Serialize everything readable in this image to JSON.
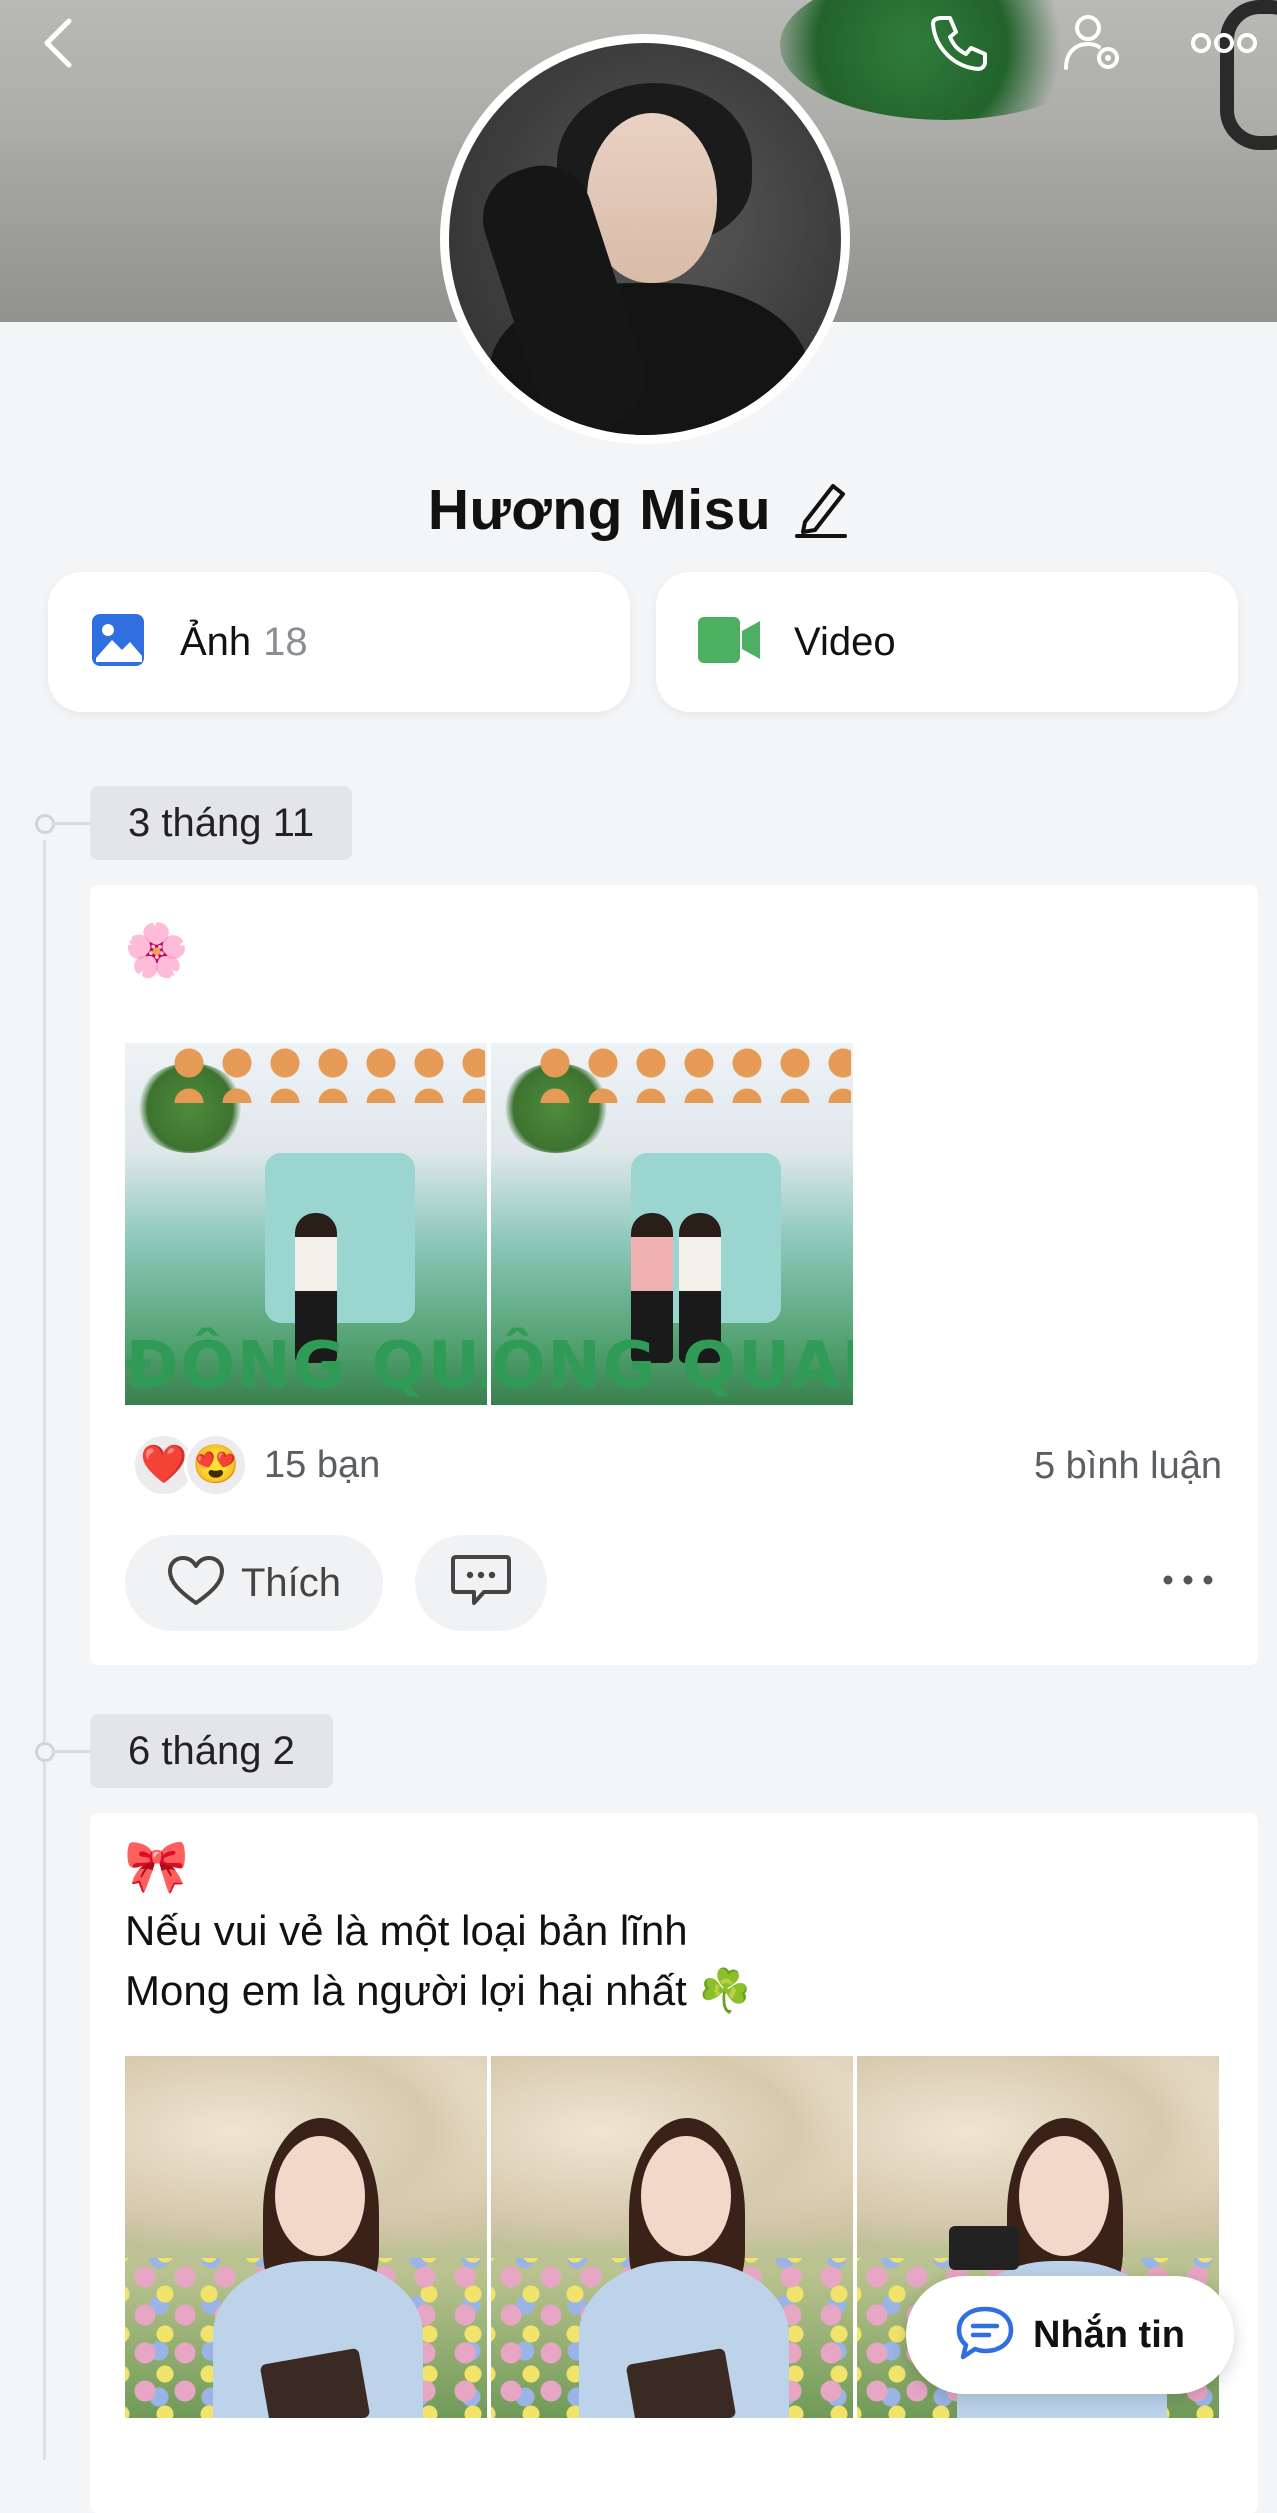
{
  "header": {
    "back_icon": "chevron-left-icon",
    "call_icon": "phone-icon",
    "settings_icon": "user-settings-icon",
    "more_icon": "more-horizontal-icon"
  },
  "profile": {
    "name": "Hương Misu",
    "edit_icon": "pencil-icon"
  },
  "media": {
    "photos": {
      "label": "Ảnh",
      "count": "18",
      "icon": "image-icon",
      "color": "#2f6fe0"
    },
    "videos": {
      "label": "Video",
      "icon": "video-camera-icon",
      "color": "#4caf62"
    }
  },
  "posts": [
    {
      "date": "3 tháng 11",
      "emoji": "🌸",
      "caption_lines": [],
      "reactions": {
        "icons": [
          "❤️",
          "😍"
        ],
        "count_text": "15 bạn"
      },
      "comments_text": "5 bình luận",
      "like_label": "Thích"
    },
    {
      "date": "6 tháng 2",
      "emoji": "🎀",
      "caption_lines": [
        "Nếu vui vẻ là một loại bản lĩnh",
        "Mong em là người lợi hại nhất ☘️"
      ]
    }
  ],
  "fab": {
    "label": "Nhắn tin",
    "icon": "chat-bubble-icon",
    "color": "#2f6fe0"
  }
}
